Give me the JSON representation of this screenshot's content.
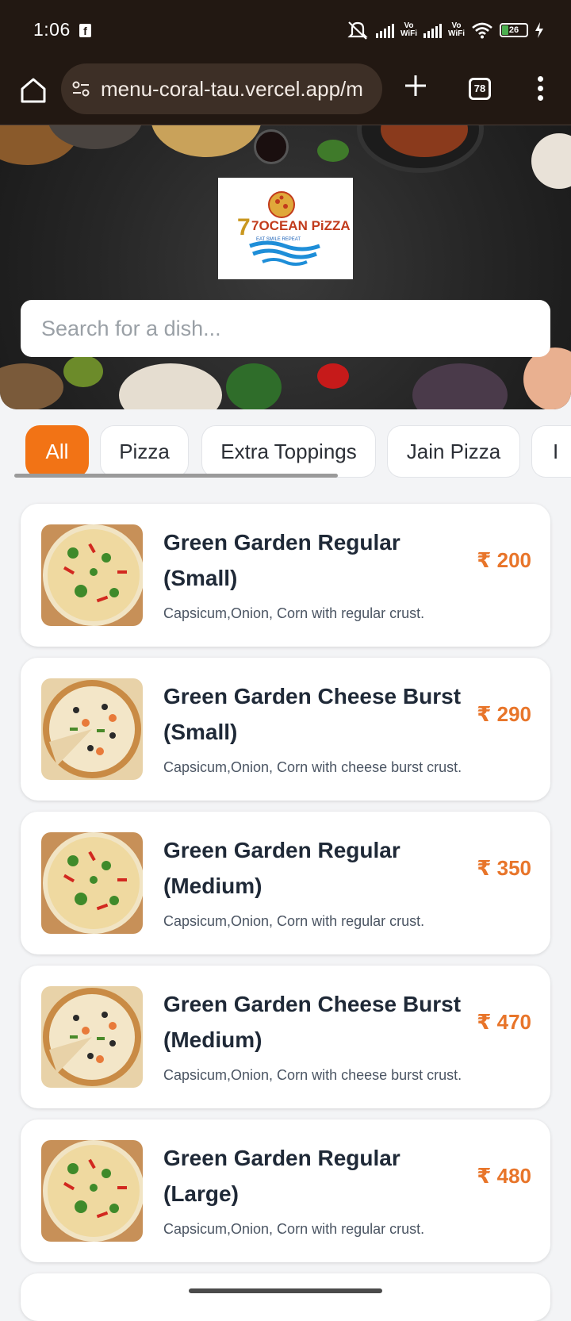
{
  "status_bar": {
    "time": "1:06",
    "fb_icon": "f",
    "vowifi_top": "Vo",
    "vowifi_bottom": "WiFi",
    "battery": "26"
  },
  "browser": {
    "url": "menu-coral-tau.vercel.app/m",
    "tab_count": "78"
  },
  "hero": {
    "logo_main": "7OCEAN PiZZA",
    "logo_tagline": "EAT SMILE REPEAT"
  },
  "search": {
    "placeholder": "Search for a dish..."
  },
  "categories": [
    {
      "label": "All",
      "active": true
    },
    {
      "label": "Pizza",
      "active": false
    },
    {
      "label": "Extra Toppings",
      "active": false
    },
    {
      "label": "Jain Pizza",
      "active": false
    },
    {
      "label": "I",
      "active": false
    }
  ],
  "menu_items": [
    {
      "name": "Green Garden Regular (Small)",
      "description": "Capsicum,Onion, Corn with regular crust.",
      "price": "₹ 200"
    },
    {
      "name": "Green Garden Cheese Burst (Small)",
      "description": "Capsicum,Onion, Corn with cheese burst crust.",
      "price": "₹ 290"
    },
    {
      "name": "Green Garden Regular (Medium)",
      "description": "Capsicum,Onion, Corn with regular crust.",
      "price": "₹ 350"
    },
    {
      "name": "Green Garden Cheese Burst (Medium)",
      "description": "Capsicum,Onion, Corn with cheese burst crust.",
      "price": "₹ 470"
    },
    {
      "name": "Green Garden Regular (Large)",
      "description": "Capsicum,Onion, Corn with regular crust.",
      "price": "₹ 480"
    }
  ],
  "colors": {
    "accent": "#f27315",
    "price": "#e8752a",
    "browser_bg": "#221812"
  }
}
